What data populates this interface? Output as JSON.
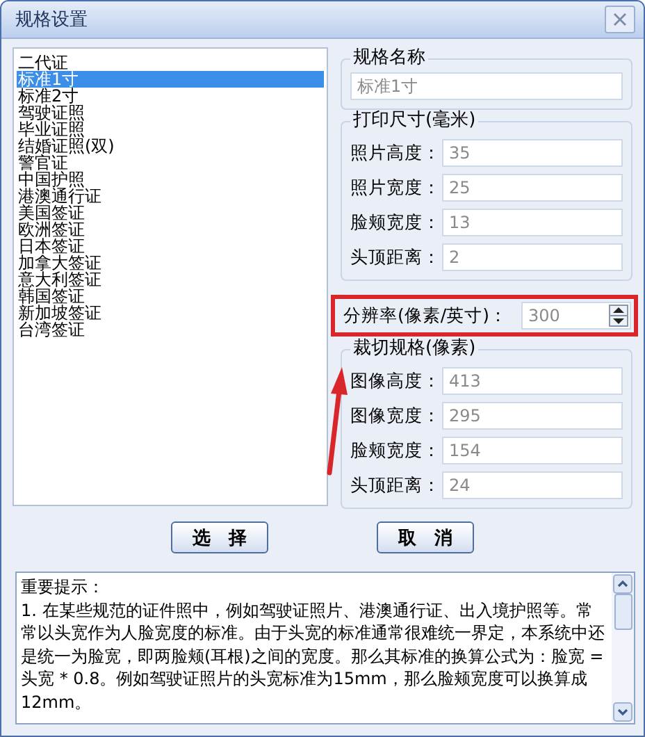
{
  "window": {
    "title": "规格设置"
  },
  "spec_list": {
    "items": [
      {
        "label": "二代证",
        "selected": false
      },
      {
        "label": "标准1寸",
        "selected": true
      },
      {
        "label": "标准2寸",
        "selected": false
      },
      {
        "label": "驾驶证照",
        "selected": false
      },
      {
        "label": "毕业证照",
        "selected": false
      },
      {
        "label": "结婚证照(双)",
        "selected": false
      },
      {
        "label": "警官证",
        "selected": false
      },
      {
        "label": "中国护照",
        "selected": false
      },
      {
        "label": "港澳通行证",
        "selected": false
      },
      {
        "label": "美国签证",
        "selected": false
      },
      {
        "label": "欧洲签证",
        "selected": false
      },
      {
        "label": "日本签证",
        "selected": false
      },
      {
        "label": "加拿大签证",
        "selected": false
      },
      {
        "label": "意大利签证",
        "selected": false
      },
      {
        "label": "韩国签证",
        "selected": false
      },
      {
        "label": "新加坡签证",
        "selected": false
      },
      {
        "label": "台湾签证",
        "selected": false
      }
    ]
  },
  "spec_name": {
    "legend": "规格名称",
    "value": "标准1寸"
  },
  "print_size": {
    "legend": "打印尺寸(毫米)",
    "fields": [
      {
        "label": "照片高度：",
        "value": "35"
      },
      {
        "label": "照片宽度：",
        "value": "25"
      },
      {
        "label": "脸颊宽度：",
        "value": "13"
      },
      {
        "label": "头顶距离：",
        "value": "2"
      }
    ]
  },
  "resolution": {
    "label": "分辨率(像素/英寸)：",
    "value": "300"
  },
  "crop_size": {
    "legend": "裁切规格(像素)",
    "fields": [
      {
        "label": "图像高度：",
        "value": "413"
      },
      {
        "label": "图像宽度：",
        "value": "295"
      },
      {
        "label": "脸颊宽度：",
        "value": "154"
      },
      {
        "label": "头顶距离：",
        "value": "24"
      }
    ]
  },
  "buttons": [
    {
      "label": "选　择"
    },
    {
      "label": "取　消"
    }
  ],
  "notes": {
    "heading": "重要提示：",
    "body": "1. 在某些规范的证件照中，例如驾驶证照片、港澳通行证、出入境护照等。常常以头宽作为人脸宽度的标准。由于头宽的标准通常很难统一界定，本系统中还是统一为脸宽，即两脸颊(耳根)之间的宽度。那么其标准的换算公式为：脸宽 = 头宽 * 0.8。例如驾驶证照片的头宽标准为15mm，那么脸颊宽度可以换算成12mm。"
  }
}
